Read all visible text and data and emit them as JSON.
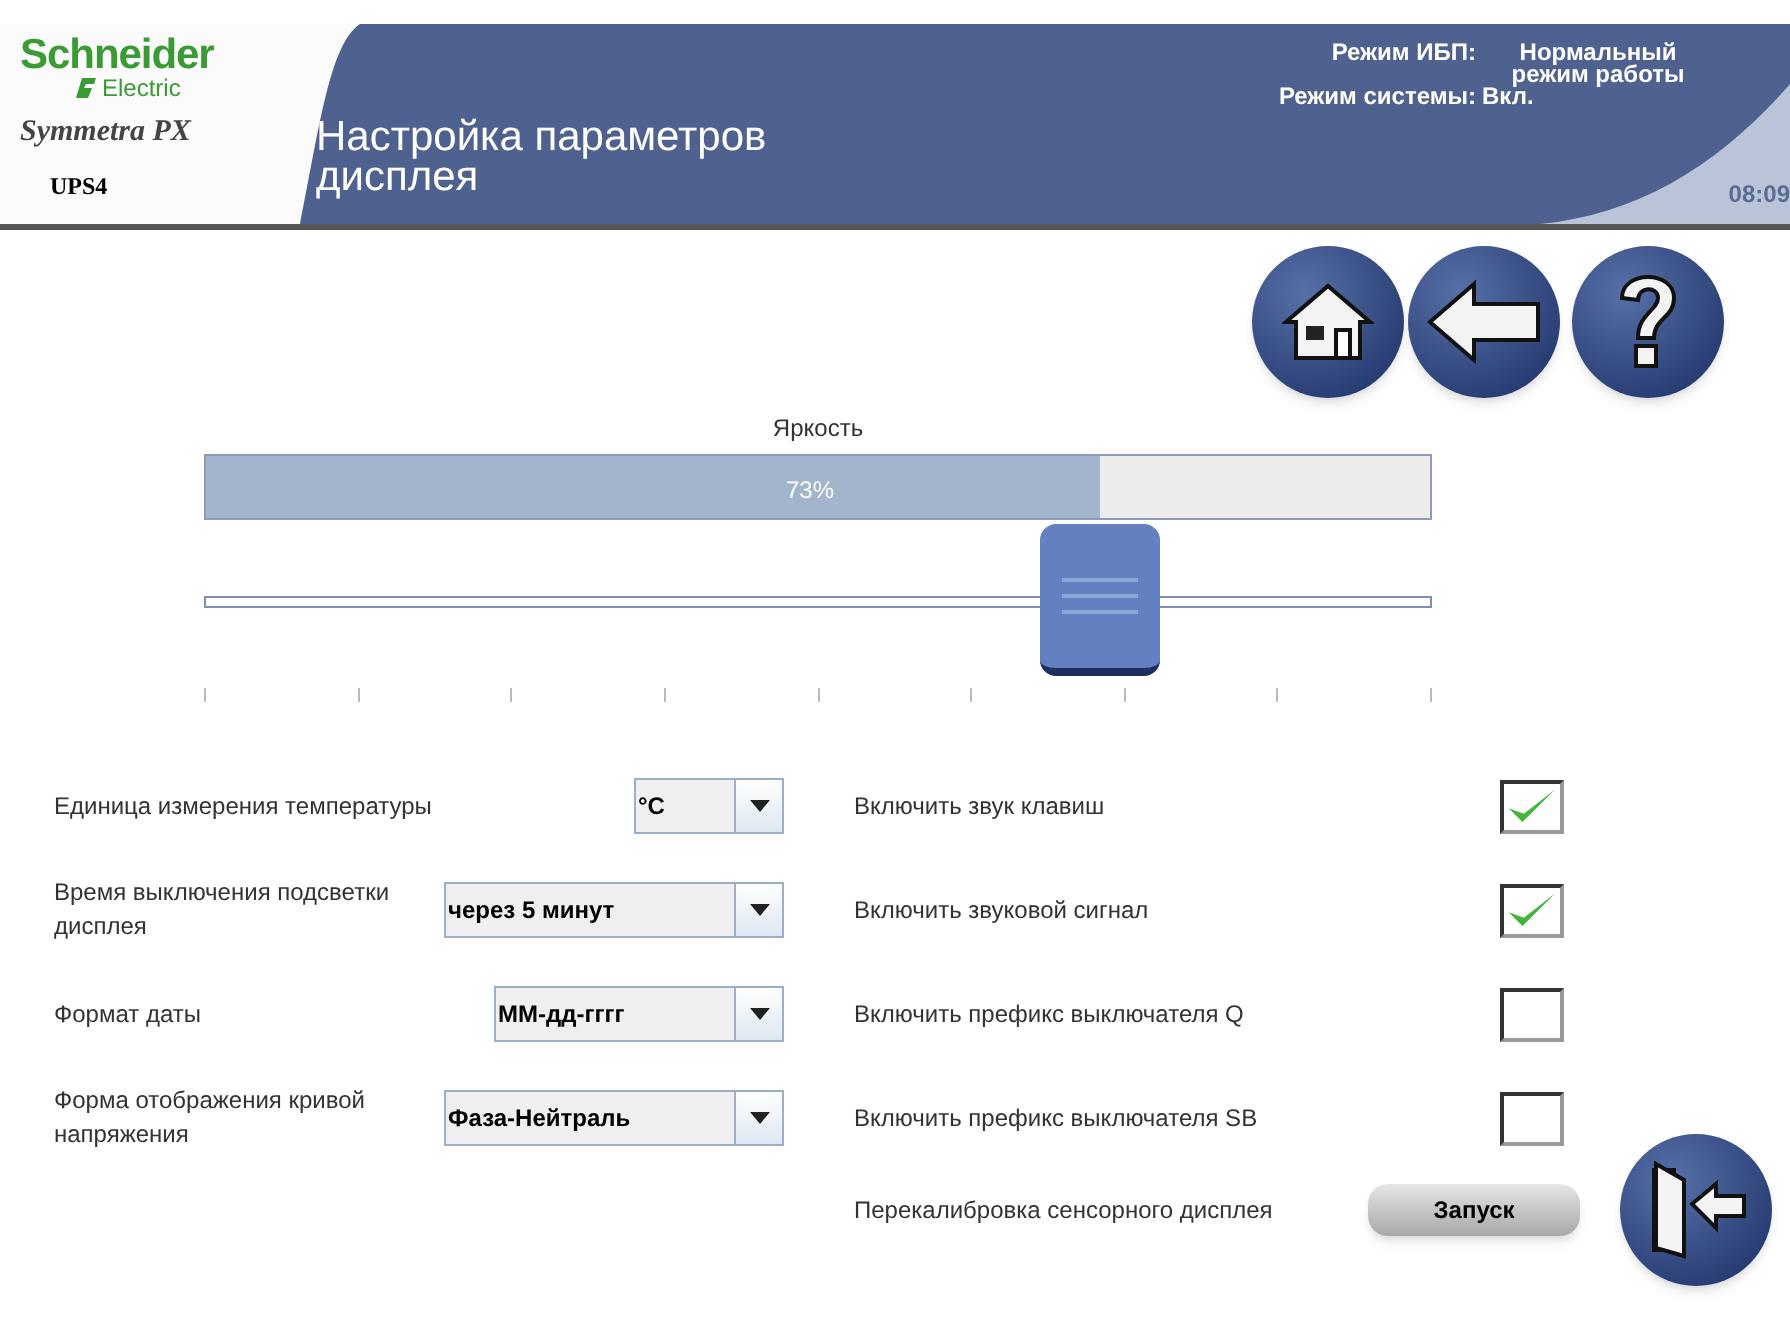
{
  "logo": {
    "brand": "Schneider",
    "sub": "Electric",
    "product": "Symmetra PX",
    "unit": "UPS4"
  },
  "header": {
    "title": "Настройка параметров дисплея",
    "status": [
      {
        "label": "Режим ИБП:",
        "value": "Нормальный режим работы"
      },
      {
        "label": "Режим системы:",
        "value": "Вкл."
      }
    ],
    "time": "08:09"
  },
  "brightness": {
    "label": "Яркость",
    "reading": "73%",
    "level": 0.73
  },
  "dropdowns": [
    {
      "label": "Единица измерения температуры",
      "value": "°C"
    },
    {
      "label": "Время выключения подсветки дисплея",
      "value": "через 5 минут"
    },
    {
      "label": "Формат даты",
      "value": "ММ-дд-гггг"
    },
    {
      "label": "Форма отображения кривой напряжения",
      "value": "Фаза-Нейтраль"
    }
  ],
  "checkboxes": [
    {
      "label": "Включить звук клавиш",
      "checked": true
    },
    {
      "label": "Включить звуковой сигнал",
      "checked": true
    },
    {
      "label": "Включить префикс выключателя Q",
      "checked": false
    },
    {
      "label": "Включить префикс выключателя SB",
      "checked": false
    }
  ],
  "calibration": {
    "label": "Перекалибровка сенсорного дисплея",
    "button": "Запуск"
  }
}
